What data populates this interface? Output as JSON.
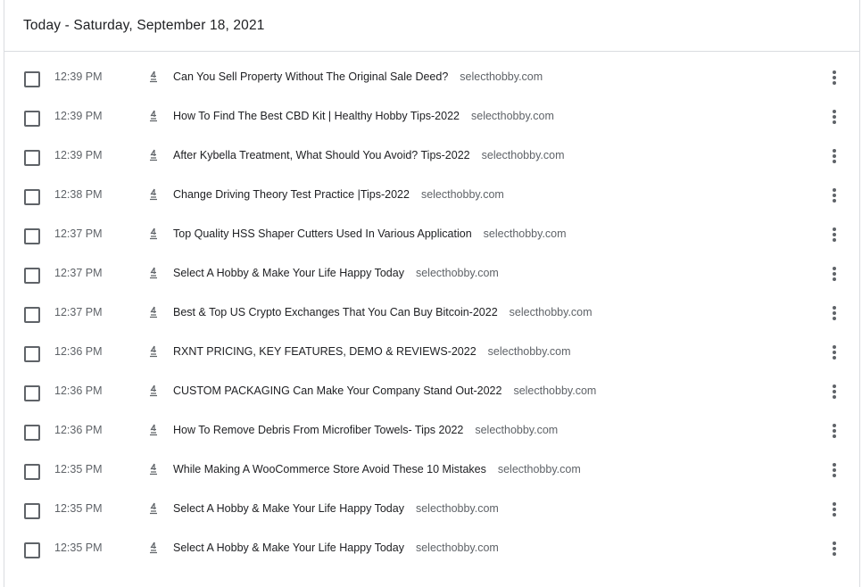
{
  "header": {
    "title": "Today - Saturday, September 18, 2021"
  },
  "icons": {
    "favicon": "selecthobby-favicon-icon",
    "row_menu": "more-vert-icon"
  },
  "colors": {
    "title_text": "#202124",
    "secondary_text": "#5f6368",
    "divider": "#dadce0"
  },
  "entries": [
    {
      "time": "12:39 PM",
      "title": "Can You Sell Property Without The Original Sale Deed?",
      "domain": "selecthobby.com"
    },
    {
      "time": "12:39 PM",
      "title": "How To Find The Best CBD Kit | Healthy Hobby Tips-2022",
      "domain": "selecthobby.com"
    },
    {
      "time": "12:39 PM",
      "title": "After Kybella Treatment, What Should You Avoid? Tips-2022",
      "domain": "selecthobby.com"
    },
    {
      "time": "12:38 PM",
      "title": "Change Driving Theory Test Practice |Tips-2022",
      "domain": "selecthobby.com"
    },
    {
      "time": "12:37 PM",
      "title": "Top Quality HSS Shaper Cutters Used In Various Application",
      "domain": "selecthobby.com"
    },
    {
      "time": "12:37 PM",
      "title": "Select A Hobby & Make Your Life Happy Today",
      "domain": "selecthobby.com"
    },
    {
      "time": "12:37 PM",
      "title": "Best & Top US Crypto Exchanges That You Can Buy Bitcoin-2022",
      "domain": "selecthobby.com"
    },
    {
      "time": "12:36 PM",
      "title": "RXNT PRICING, KEY FEATURES, DEMO & REVIEWS-2022",
      "domain": "selecthobby.com"
    },
    {
      "time": "12:36 PM",
      "title": "CUSTOM PACKAGING Can Make Your Company Stand Out-2022",
      "domain": "selecthobby.com"
    },
    {
      "time": "12:36 PM",
      "title": "How To Remove Debris From Microfiber Towels- Tips 2022",
      "domain": "selecthobby.com"
    },
    {
      "time": "12:35 PM",
      "title": "While Making A WooCommerce Store Avoid These 10 Mistakes",
      "domain": "selecthobby.com"
    },
    {
      "time": "12:35 PM",
      "title": "Select A Hobby & Make Your Life Happy Today",
      "domain": "selecthobby.com"
    },
    {
      "time": "12:35 PM",
      "title": "Select A Hobby & Make Your Life Happy Today",
      "domain": "selecthobby.com"
    }
  ]
}
